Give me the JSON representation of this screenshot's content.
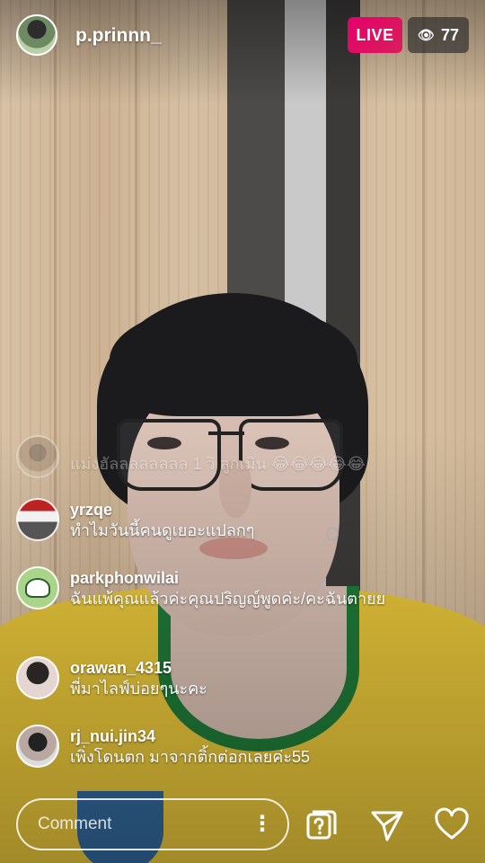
{
  "header": {
    "username": "p.prinnn_",
    "live_label": "LIVE",
    "viewer_count": "77"
  },
  "comments": [
    {
      "user": "",
      "text": "แม่งฮัลลลลลลลล 1 วิ ลูกเมิน 😂😂😂😂😂"
    },
    {
      "user": "yrzqe",
      "text": "ทำไมวันนี้คนดูเยอะแปลกๆ"
    },
    {
      "user": "parkphonwilai",
      "text": "ฉันแพ้คุณแล้วค่ะคุณปริญญ์พูดค่ะ/คะฉันตายย"
    },
    {
      "user": "orawan_4315",
      "text": "พี่มาไลฟ์บ่อยๆนะคะ"
    },
    {
      "user": "rj_nui.jin34",
      "text": "เพิ่งโดนตก มาจากติ้กต่อกเลยค่ะ55"
    }
  ],
  "footer": {
    "comment_placeholder": "Comment",
    "more_glyph": "⋮",
    "icons": [
      "question-icon",
      "send-icon",
      "heart-icon"
    ]
  },
  "colors": {
    "live_badge": "#e5006a",
    "viewer_badge": "#282828"
  }
}
